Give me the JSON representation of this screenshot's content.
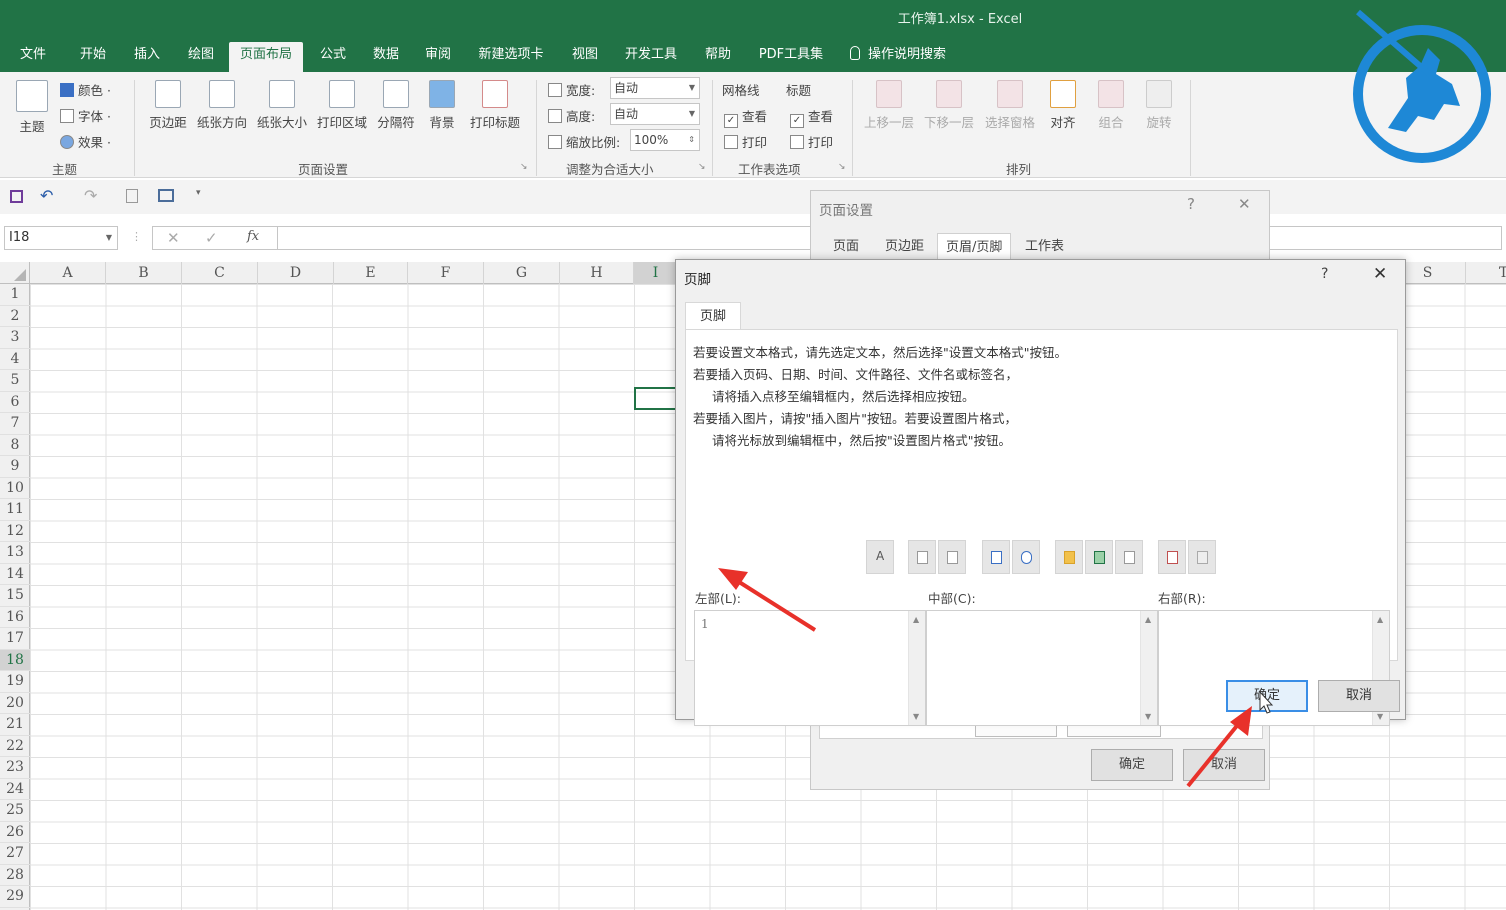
{
  "window": {
    "title": "工作簿1.xlsx  -  Excel"
  },
  "ribbon_tabs": [
    "文件",
    "开始",
    "插入",
    "绘图",
    "页面布局",
    "公式",
    "数据",
    "审阅",
    "新建选项卡",
    "视图",
    "开发工具",
    "帮助",
    "PDF工具集",
    "操作说明搜索"
  ],
  "ribbon": {
    "theme": {
      "main": "主题",
      "colors": "颜色 ·",
      "fonts": "字体 ·",
      "effects": "效果 ·",
      "group": "主题"
    },
    "page_setup": {
      "buttons": [
        "页边距",
        "纸张方向",
        "纸张大小",
        "打印区域",
        "分隔符",
        "背景",
        "打印标题"
      ],
      "group": "页面设置"
    },
    "scale": {
      "width_label": "宽度:",
      "width_value": "自动",
      "height_label": "高度:",
      "height_value": "自动",
      "scale_label": "缩放比例:",
      "scale_value": "100%",
      "group": "调整为合适大小"
    },
    "sheet_options": {
      "gridlines": "网格线",
      "headings": "标题",
      "view": "查看",
      "print": "打印",
      "group": "工作表选项"
    },
    "arrange": {
      "buttons": [
        "上移一层",
        "下移一层",
        "选择窗格",
        "对齐",
        "组合",
        "旋转"
      ],
      "group": "排列"
    }
  },
  "formula_bar": {
    "name_box": "I18",
    "fx": "fx"
  },
  "columns": [
    "A",
    "B",
    "C",
    "D",
    "E",
    "F",
    "G",
    "H",
    "I",
    "S",
    "T"
  ],
  "rows": [
    "1",
    "2",
    "3",
    "4",
    "5",
    "6",
    "7",
    "8",
    "9",
    "10",
    "11",
    "12",
    "13",
    "14",
    "15",
    "16",
    "17",
    "18",
    "19",
    "20",
    "21",
    "22",
    "23",
    "24",
    "25",
    "26",
    "27",
    "28",
    "29"
  ],
  "page_setup_dialog": {
    "title": "页面设置",
    "help": "?",
    "close": "✕",
    "tabs": [
      "页面",
      "页边距",
      "页眉/页脚",
      "工作表"
    ],
    "active_tab": "页眉/页脚",
    "ok": "确定",
    "cancel": "取消"
  },
  "footer_dialog": {
    "title": "页脚",
    "help": "?",
    "close": "✕",
    "tab": "页脚",
    "instructions": [
      "若要设置文本格式，请先选定文本，然后选择\"设置文本格式\"按钮。",
      "若要插入页码、日期、时间、文件路径、文件名或标签名，",
      "请将插入点移至编辑框内，然后选择相应按钮。",
      "若要插入图片，请按\"插入图片\"按钮。若要设置图片格式，",
      "请将光标放到编辑框中，然后按\"设置图片格式\"按钮。"
    ],
    "toolbar": [
      "format-text",
      "page-number",
      "page-count",
      "date",
      "time",
      "file-path",
      "file-name",
      "sheet-name",
      "insert-picture",
      "format-picture"
    ],
    "toolbar_first_glyph": "A",
    "left_label": "左部(L):",
    "center_label": "中部(C):",
    "right_label": "右部(R):",
    "left_value": "1",
    "center_value": "",
    "right_value": "",
    "ok": "确定",
    "cancel": "取消"
  },
  "colors": {
    "excel_green": "#217346",
    "annotation_red": "#e8312a",
    "logo_blue": "#1e88d6"
  }
}
